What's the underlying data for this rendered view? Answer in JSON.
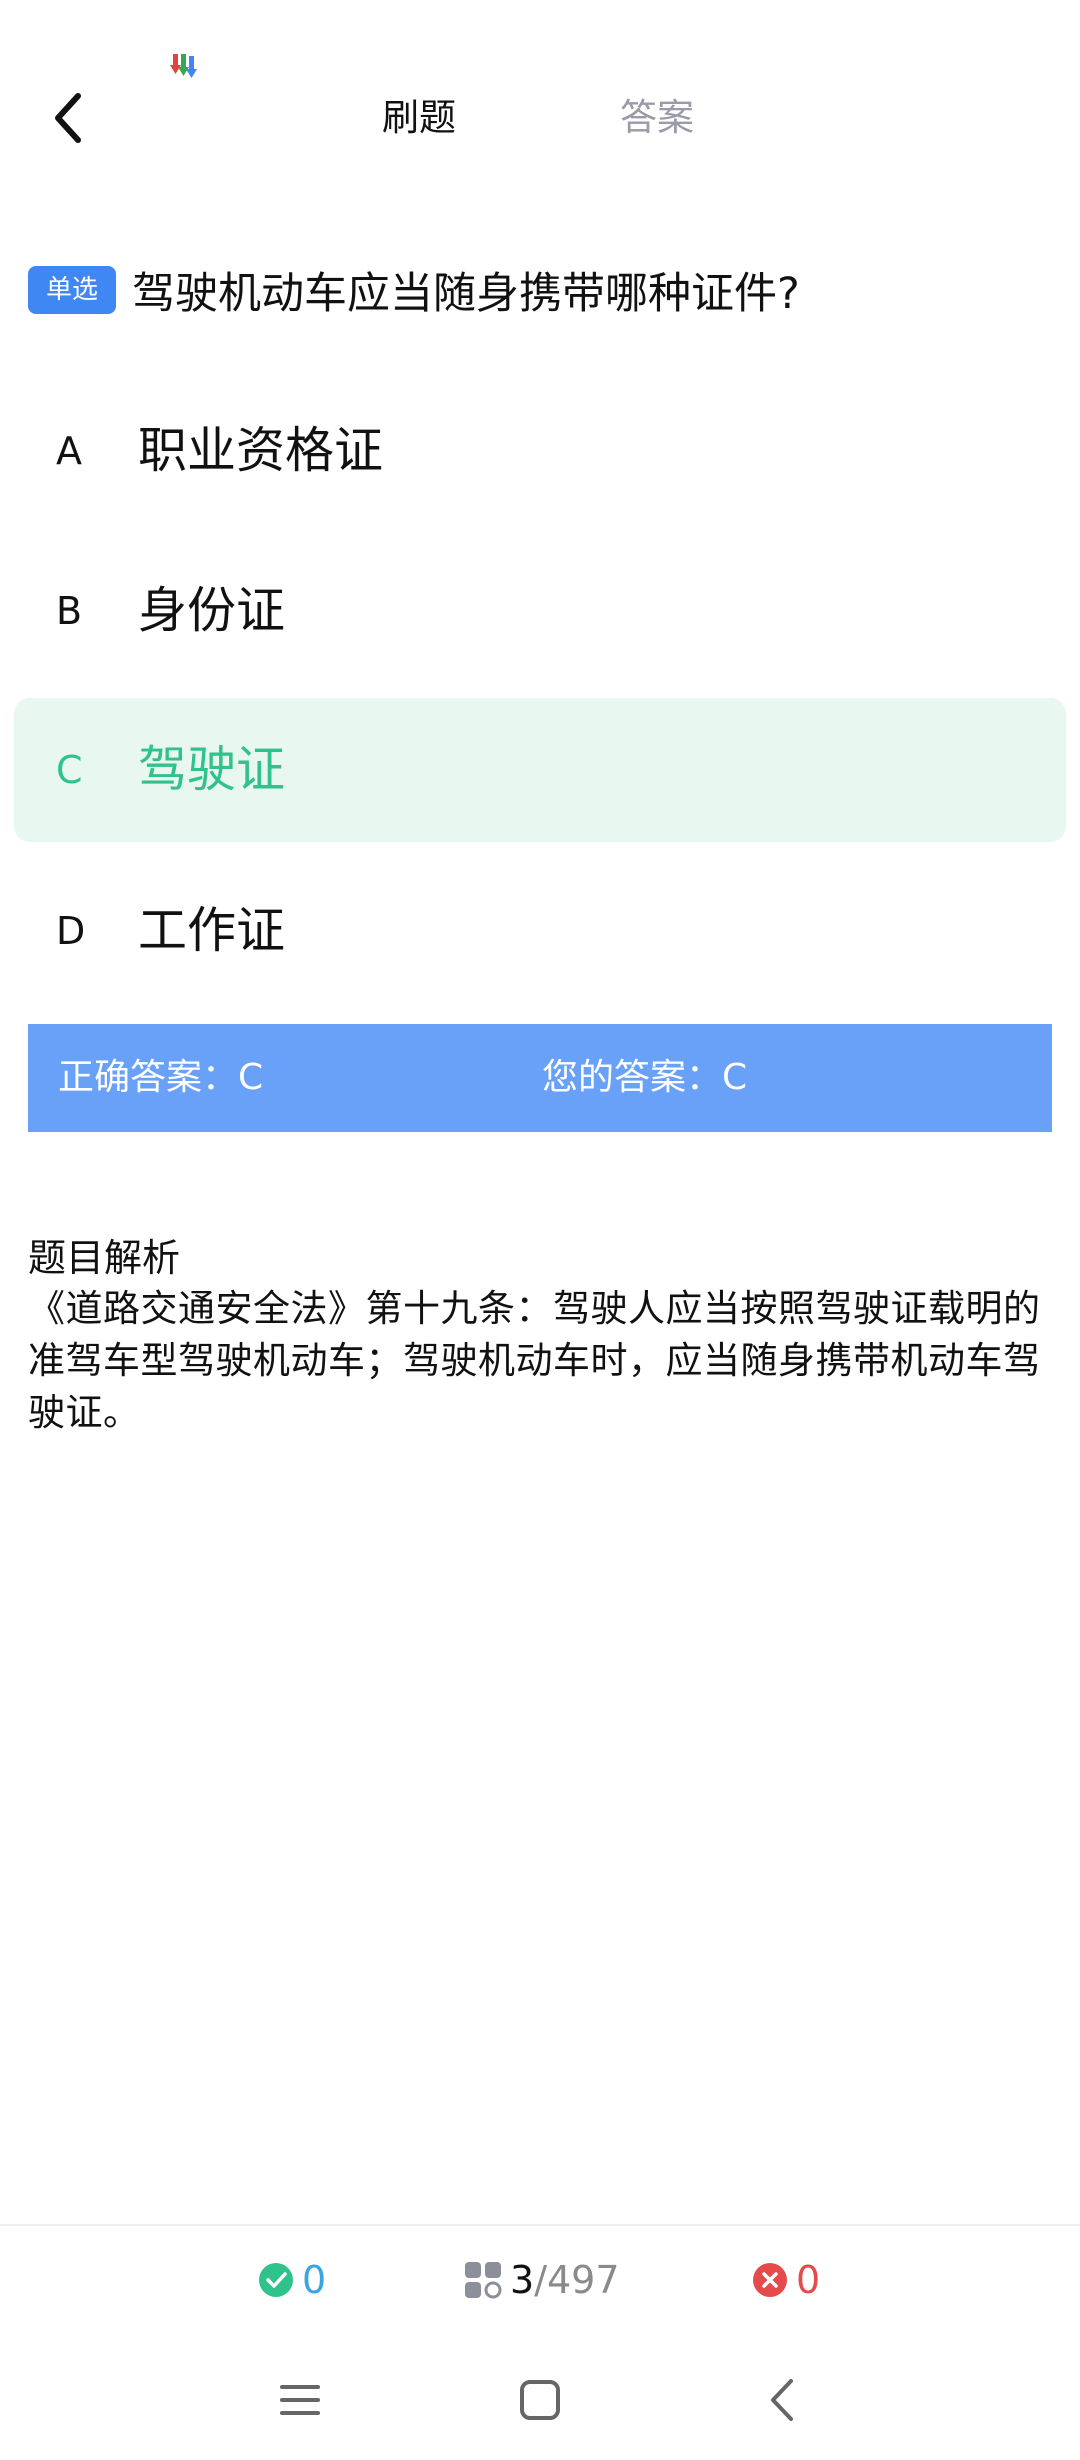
{
  "colors": {
    "accent_blue": "#3f87f3",
    "answer_bar": "#69a1f8",
    "selected_bg": "#e8f7ef",
    "selected_text": "#2fc28a",
    "correct_count": "#3aa3e0",
    "wrong_count": "#e54b4b"
  },
  "header": {
    "back_icon": "chevron-left-icon",
    "tabs": [
      {
        "label": "刷题",
        "active": true
      },
      {
        "label": "答案",
        "active": false
      }
    ]
  },
  "question": {
    "type_badge": "单选",
    "text": "驾驶机动车应当随身携带哪种证件?",
    "options": [
      {
        "letter": "A",
        "text": "职业资格证",
        "selected": false
      },
      {
        "letter": "B",
        "text": "身份证",
        "selected": false
      },
      {
        "letter": "C",
        "text": "驾驶证",
        "selected": true
      },
      {
        "letter": "D",
        "text": "工作证",
        "selected": false
      }
    ]
  },
  "answer_bar": {
    "correct_text": "正确答案：C",
    "yours_text": "您的答案：C"
  },
  "explanation": {
    "title": "题目解析",
    "body": "《道路交通安全法》第十九条：驾驶人应当按照驾驶证载明的准驾车型驾驶机动车；驾驶机动车时，应当随身携带机动车驾驶证。"
  },
  "bottom_bar": {
    "correct_count": "0",
    "progress_current": "3",
    "progress_total": "/497",
    "wrong_count": "0"
  },
  "system_nav": {
    "menu_icon": "menu-icon",
    "home_icon": "home-square-icon",
    "back_icon": "back-chevron-icon"
  }
}
